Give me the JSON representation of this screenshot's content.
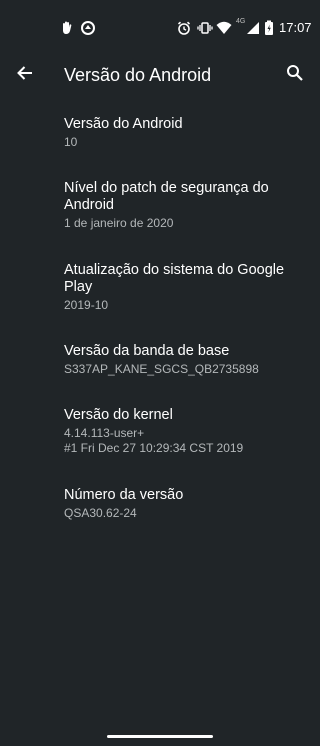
{
  "status_bar": {
    "time": "17:07",
    "network_label": "4G",
    "icons": [
      "hand-notification-icon",
      "circle-notification-icon",
      "alarm-icon",
      "vibrate-icon",
      "wifi-icon",
      "signal-icon",
      "battery-icon"
    ]
  },
  "toolbar": {
    "title": "Versão do Android",
    "back_icon": "arrow-back-icon",
    "search_icon": "search-icon"
  },
  "items": [
    {
      "title": "Versão do Android",
      "summary": "10"
    },
    {
      "title": "Nível do patch de segurança do Android",
      "summary": "1 de janeiro de 2020"
    },
    {
      "title": "Atualização do sistema do Google Play",
      "summary": "2019-10"
    },
    {
      "title": "Versão da banda de base",
      "summary": "S337AP_KANE_SGCS_QB2735898"
    },
    {
      "title": "Versão do kernel",
      "summary": "4.14.113-user+\n#1 Fri Dec 27 10:29:34 CST 2019"
    },
    {
      "title": "Número da versão",
      "summary": "QSA30.62-24"
    }
  ],
  "colors": {
    "background": "#202528",
    "primary_text": "#ffffff",
    "secondary_text": "#b4b8ba"
  }
}
